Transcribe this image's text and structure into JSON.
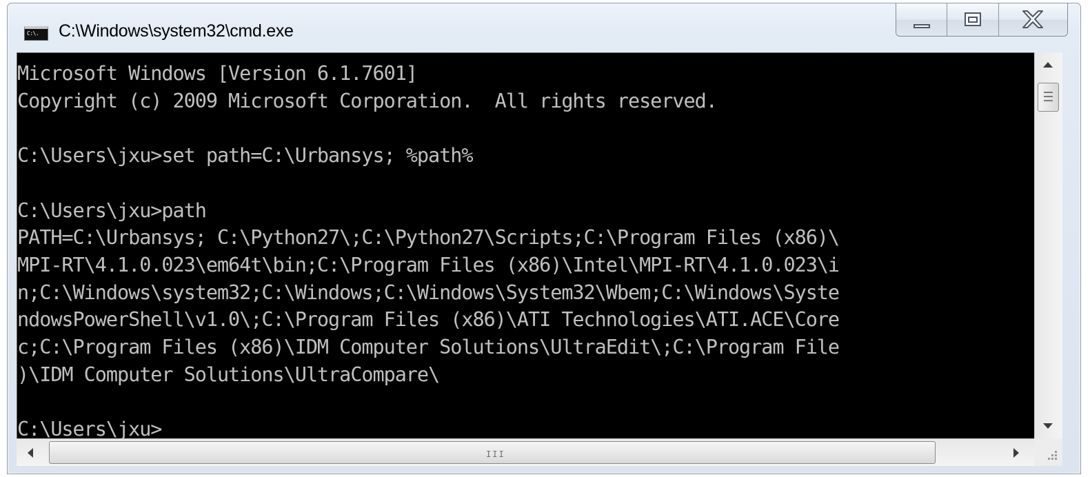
{
  "window": {
    "title": "C:\\Windows\\system32\\cmd.exe",
    "app_icon_text": "C:\\."
  },
  "caption_buttons": {
    "minimize": "minimize",
    "maximize": "maximize",
    "close": "close"
  },
  "console": {
    "lines": [
      "Microsoft Windows [Version 6.1.7601]",
      "Copyright (c) 2009 Microsoft Corporation.  All rights reserved.",
      "",
      "C:\\Users\\jxu>set path=C:\\Urbansys; %path%",
      "",
      "C:\\Users\\jxu>path",
      "PATH=C:\\Urbansys; C:\\Python27\\;C:\\Python27\\Scripts;C:\\Program Files (x86)\\",
      "MPI-RT\\4.1.0.023\\em64t\\bin;C:\\Program Files (x86)\\Intel\\MPI-RT\\4.1.0.023\\i",
      "n;C:\\Windows\\system32;C:\\Windows;C:\\Windows\\System32\\Wbem;C:\\Windows\\Syste",
      "ndowsPowerShell\\v1.0\\;C:\\Program Files (x86)\\ATI Technologies\\ATI.ACE\\Core",
      "c;C:\\Program Files (x86)\\IDM Computer Solutions\\UltraEdit\\;C:\\Program File",
      ")\\IDM Computer Solutions\\UltraCompare\\",
      "",
      "C:\\Users\\jxu>"
    ]
  },
  "scrollbar": {
    "h_grip": "III"
  },
  "colors": {
    "console_bg": "#000000",
    "console_fg": "#c0c0c0"
  }
}
